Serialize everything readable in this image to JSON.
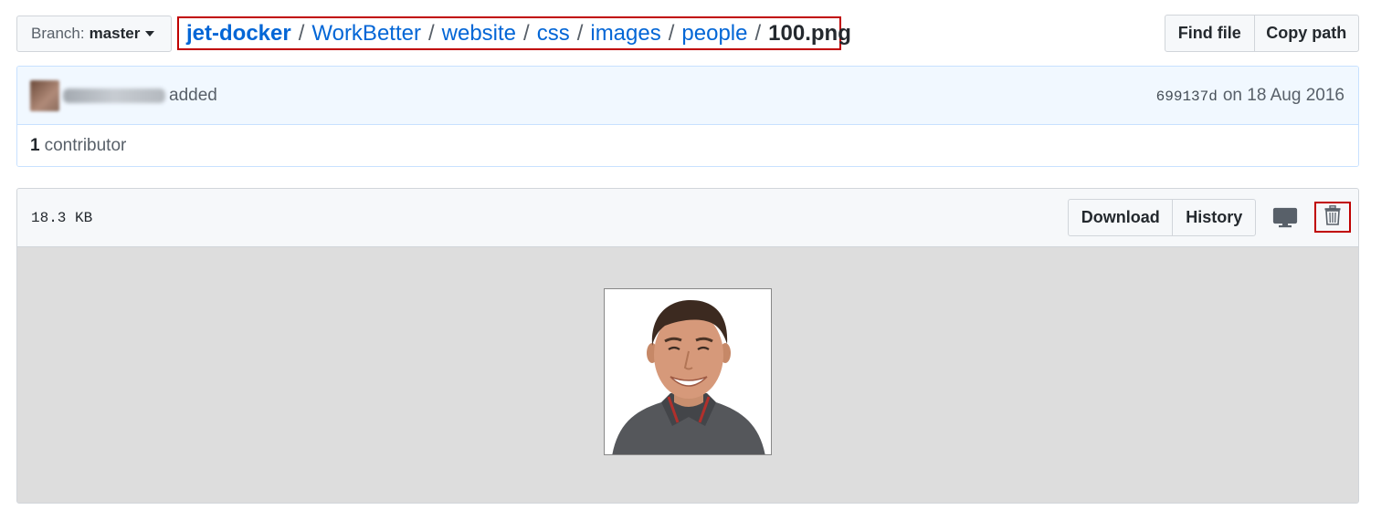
{
  "branch": {
    "label": "Branch:",
    "value": "master"
  },
  "breadcrumb": {
    "repo": "jet-docker",
    "parts": [
      "WorkBetter",
      "website",
      "css",
      "images",
      "people"
    ],
    "separator": "/",
    "file": "100.png"
  },
  "top_actions": {
    "find_file": "Find file",
    "copy_path": "Copy path"
  },
  "commit": {
    "message": "added",
    "sha": "699137d",
    "date": "on 18 Aug 2016",
    "contributors_count": "1",
    "contributors_label": "contributor"
  },
  "file": {
    "size": "18.3 KB",
    "download": "Download",
    "history": "History"
  },
  "colors": {
    "link": "#0366d6",
    "highlight_border": "#c00000",
    "commit_bg": "#f1f8ff",
    "image_bg": "#dddddd"
  },
  "icons": [
    "caret-down-icon",
    "desktop-icon",
    "trash-icon"
  ]
}
